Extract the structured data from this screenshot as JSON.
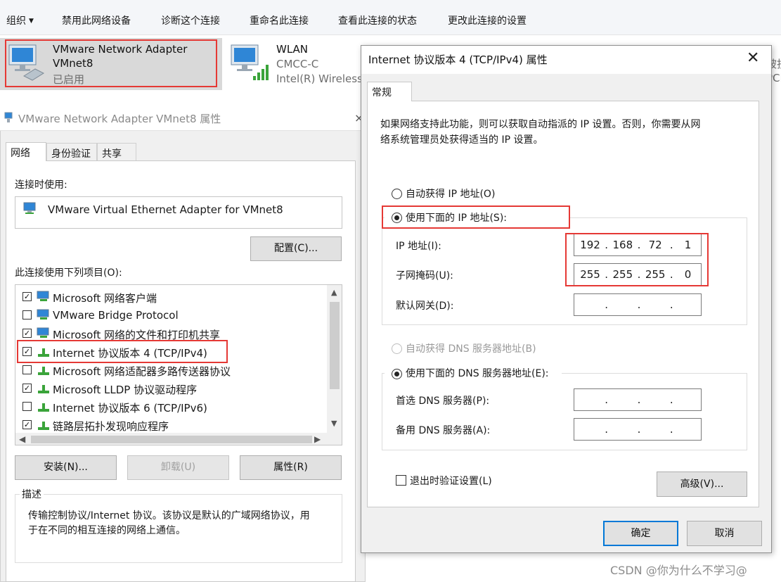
{
  "toolbar": {
    "organize": "组织",
    "disable": "禁用此网络设备",
    "diagnose": "诊断这个连接",
    "rename": "重命名此连接",
    "view_status": "查看此连接的状态",
    "change_settings": "更改此连接的设置"
  },
  "adapters": [
    {
      "name": "VMware Network Adapter",
      "name2": "VMnet8",
      "status": "已启用"
    },
    {
      "name": "WLAN",
      "name2": "CMCC-C",
      "status": "Intel(R) Wireless-"
    }
  ],
  "edge_fragment": {
    "line1": "被扐",
    "line2": "PCI"
  },
  "left_window": {
    "title": "VMware Network Adapter VMnet8 属性",
    "close": "×",
    "tabs": [
      "网络",
      "身份验证",
      "共享"
    ],
    "connect_using_label": "连接时使用:",
    "adapter_name": "VMware Virtual Ethernet Adapter for VMnet8",
    "configure_button": "配置(C)...",
    "items_label": "此连接使用下列项目(O):",
    "items": [
      {
        "label": "Microsoft 网络客户端",
        "checked": true
      },
      {
        "label": "VMware Bridge Protocol",
        "checked": false
      },
      {
        "label": "Microsoft 网络的文件和打印机共享",
        "checked": true
      },
      {
        "label": "Internet 协议版本 4 (TCP/IPv4)",
        "checked": true
      },
      {
        "label": "Microsoft 网络适配器多路传送器协议",
        "checked": false
      },
      {
        "label": "Microsoft LLDP 协议驱动程序",
        "checked": true
      },
      {
        "label": "Internet 协议版本 6 (TCP/IPv6)",
        "checked": false
      },
      {
        "label": "链路层拓扑发现响应程序",
        "checked": true
      }
    ],
    "install_button": "安装(N)...",
    "uninstall_button": "卸载(U)",
    "properties_button": "属性(R)",
    "description_label": "描述",
    "description_text_1": "传输控制协议/Internet 协议。该协议是默认的广域网络协议，用",
    "description_text_2": "于在不同的相互连接的网络上通信。"
  },
  "right_window": {
    "title": "Internet 协议版本 4 (TCP/IPv4) 属性",
    "tab": "常规",
    "intro_1": "如果网络支持此功能，则可以获取自动指派的 IP 设置。否则，你需要从网",
    "intro_2": "络系统管理员处获得适当的 IP 设置。",
    "auto_ip": "自动获得 IP 地址(O)",
    "manual_ip": "使用下面的 IP 地址(S):",
    "ip_label": "IP 地址(I):",
    "ip_value": [
      "192",
      "168",
      "72",
      "1"
    ],
    "mask_label": "子网掩码(U):",
    "mask_value": [
      "255",
      "255",
      "255",
      "0"
    ],
    "gateway_label": "默认网关(D):",
    "auto_dns": "自动获得 DNS 服务器地址(B)",
    "manual_dns": "使用下面的 DNS 服务器地址(E):",
    "preferred_dns_label": "首选 DNS 服务器(P):",
    "alternate_dns_label": "备用 DNS 服务器(A):",
    "validate_on_exit": "退出时验证设置(L)",
    "advanced_button": "高级(V)...",
    "ok_button": "确定",
    "cancel_button": "取消"
  },
  "watermark": "CSDN @你为什么不学习@"
}
